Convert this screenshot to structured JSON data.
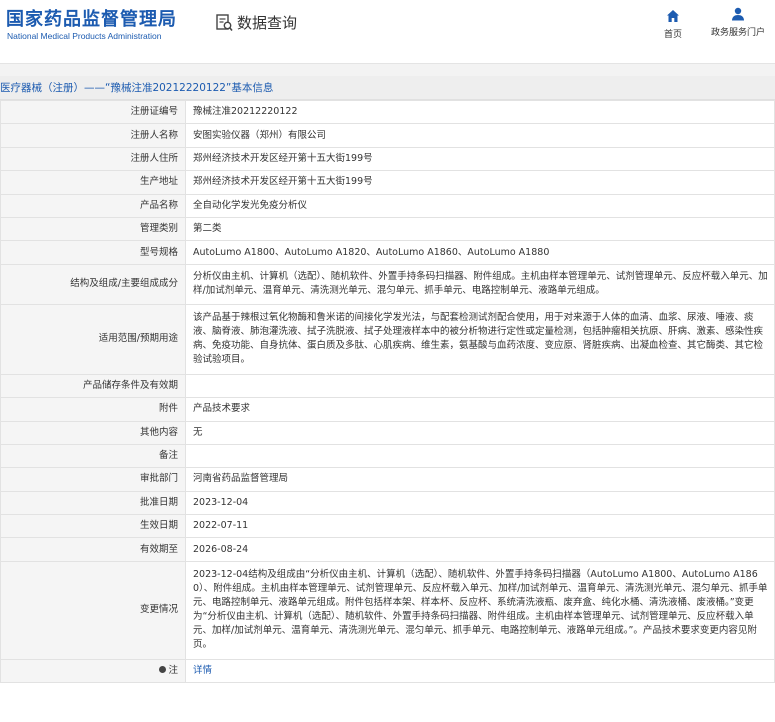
{
  "header": {
    "logo_cn": "国家药品监督管理局",
    "logo_en": "National Medical Products Administration",
    "page_title": "数据查询",
    "colors": {
      "brand": "#1c5bb0"
    }
  },
  "nav": {
    "home": {
      "label": "首页",
      "icon": "home-icon"
    },
    "service": {
      "label": "政务服务门户",
      "icon": "user-icon"
    }
  },
  "section": {
    "title": "医疗器械（注册）——“豫械注准20212220122”基本信息"
  },
  "rows": [
    {
      "label": "注册证编号",
      "value": "豫械注准20212220122"
    },
    {
      "label": "注册人名称",
      "value": "安图实验仪器（郑州）有限公司"
    },
    {
      "label": "注册人住所",
      "value": "郑州经济技术开发区经开第十五大街199号"
    },
    {
      "label": "生产地址",
      "value": "郑州经济技术开发区经开第十五大街199号"
    },
    {
      "label": "产品名称",
      "value": "全自动化学发光免疫分析仪"
    },
    {
      "label": "管理类别",
      "value": "第二类"
    },
    {
      "label": "型号规格",
      "value": "AutoLumo A1800、AutoLumo A1820、AutoLumo A1860、AutoLumo A1880"
    },
    {
      "label": "结构及组成/主要组成成分",
      "value": "分析仪由主机、计算机（选配）、随机软件、外置手持条码扫描器、附件组成。主机由样本管理单元、试剂管理单元、反应杯载入单元、加样/加试剂单元、温育单元、清洗测光单元、混匀单元、抓手单元、电路控制单元、液路单元组成。"
    },
    {
      "label": "适用范围/预期用途",
      "value": "该产品基于辣根过氧化物酶和鲁米诺的间接化学发光法，与配套检测试剂配合使用，用于对来源于人体的血清、血浆、尿液、唾液、痰液、脑脊液、肺泡灌洗液、拭子洗脱液、拭子处理液样本中的被分析物进行定性或定量检测，包括肿瘤相关抗原、肝病、激素、感染性疾病、免疫功能、自身抗体、蛋白质及多肽、心肌疾病、维生素，氨基酸与血药浓度、变应原、肾脏疾病、出凝血检查、其它酶类、其它检验试验项目。"
    },
    {
      "label": "产品储存条件及有效期",
      "value": ""
    },
    {
      "label": "附件",
      "value": "产品技术要求"
    },
    {
      "label": "其他内容",
      "value": "无"
    },
    {
      "label": "备注",
      "value": ""
    },
    {
      "label": "审批部门",
      "value": "河南省药品监督管理局"
    },
    {
      "label": "批准日期",
      "value": "2023-12-04"
    },
    {
      "label": "生效日期",
      "value": "2022-07-11"
    },
    {
      "label": "有效期至",
      "value": "2026-08-24"
    },
    {
      "label": "变更情况",
      "value": "2023-12-04结构及组成由“分析仪由主机、计算机（选配）、随机软件、外置手持条码扫描器（AutoLumo A1800、AutoLumo A1860）、附件组成。主机由样本管理单元、试剂管理单元、反应杯载入单元、加样/加试剂单元、温育单元、清洗测光单元、混匀单元、抓手单元、电路控制单元、液路单元组成。附件包括样本架、样本杯、反应杯、系统清洗液瓶、废弃盒、纯化水桶、清洗液桶、废液桶。”变更为“分析仪由主机、计算机（选配）、随机软件、外置手持条码扫描器、附件组成。主机由样本管理单元、试剂管理单元、反应杯载入单元、加样/加试剂单元、温育单元、清洗测光单元、混匀单元、抓手单元、电路控制单元、液路单元组成。”。产品技术要求变更内容见附页。"
    }
  ],
  "note": {
    "label": "注",
    "link": "详情",
    "icon": "pin-icon"
  }
}
